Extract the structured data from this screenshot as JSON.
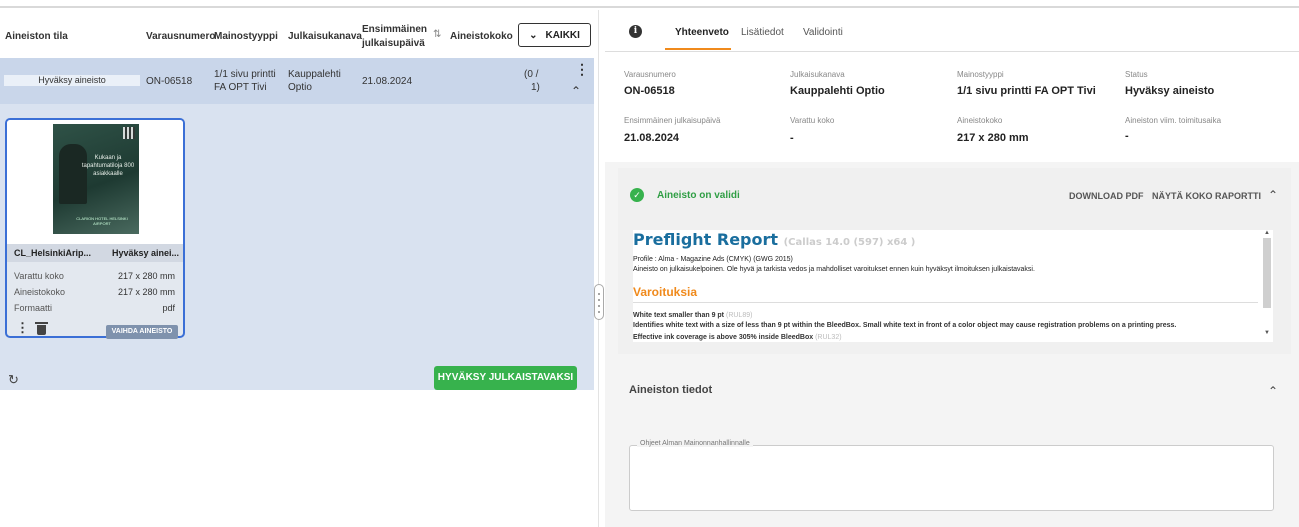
{
  "table": {
    "headers": {
      "aineiston_tila": "Aineiston tila",
      "varausnumero": "Varausnumero",
      "mainostyyppi": "Mainostyyppi",
      "julkaisukanava": "Julkaisukanava",
      "ensimmainen_1": "Ensimmäinen",
      "ensimmainen_2": "julkaisupäivä",
      "aineistokoko": "Aineistokoko"
    },
    "filter_button": "KAIKKI",
    "row": {
      "status": "Hyväksy aineisto",
      "varausnumero": "ON-06518",
      "mainostyyppi_1": "1/1 sivu printti",
      "mainostyyppi_2": "FA OPT Tivi",
      "julkaisukanava_1": "Kauppalehti",
      "julkaisukanava_2": "Optio",
      "paiva": "21.08.2024",
      "koko_1": "(0 /",
      "koko_2": "1)"
    }
  },
  "card": {
    "thumbnail_title": "Kukaan ja tapahtumatiloja 800 asiakkaalle",
    "thumbnail_footer": "CLARION HOTEL HELSINKI AIRPORT",
    "filename": "CL_HelsinkiArip...",
    "status": "Hyväksy ainei...",
    "rows": [
      {
        "label": "Varattu koko",
        "value": "217 x 280 mm"
      },
      {
        "label": "Aineistokoko",
        "value": "217 x 280 mm"
      },
      {
        "label": "Formaatti",
        "value": "pdf"
      }
    ],
    "change_button": "VAIHDA AINEISTO"
  },
  "approve_button": "HYVÄKSY JULKAISTAVAKSI",
  "tabs": {
    "summary": "Yhteenveto",
    "extra": "Lisätiedot",
    "validation": "Validointi"
  },
  "summary": {
    "varausnumero": {
      "label": "Varausnumero",
      "value": "ON-06518"
    },
    "julkaisukanava": {
      "label": "Julkaisukanava",
      "value": "Kauppalehti Optio"
    },
    "mainostyyppi": {
      "label": "Mainostyyppi",
      "value": "1/1 sivu printti FA OPT Tivi"
    },
    "status": {
      "label": "Status",
      "value": "Hyväksy aineisto"
    },
    "ensimmainen": {
      "label": "Ensimmäinen julkaisupäivä",
      "value": "21.08.2024"
    },
    "varattu_koko": {
      "label": "Varattu koko",
      "value": "-"
    },
    "aineistokoko": {
      "label": "Aineistokoko",
      "value": "217 x 280 mm"
    },
    "toimitusaika": {
      "label": "Aineiston viim. toimitusaika",
      "value": "-"
    }
  },
  "preflight": {
    "valid_text": "Aineisto on validi",
    "download_pdf": "DOWNLOAD PDF",
    "show_report": "NÄYTÄ KOKO RAPORTTI",
    "report_title": "Preflight Report",
    "report_version": "(Callas 14.0 (597) x64 )",
    "profile": "Profile : Alma - Magazine Ads (CMYK) (GWG 2015)",
    "note": "Aineisto on julkaisukelpoinen. Ole hyvä ja tarkista vedos ja mahdolliset varoitukset ennen kuin hyväksyt ilmoituksen julkaistavaksi.",
    "warnings_title": "Varoituksia",
    "items": [
      {
        "text": "White text smaller than 9 pt",
        "code": "(RUL89)"
      },
      {
        "text": "Identifies white text with a size of less than 9 pt within the BleedBox. Small white text in front of a color object may cause registration problems on a printing press.",
        "code": ""
      },
      {
        "text": "Effective ink coverage is above 305% inside BleedBox",
        "code": "(RUL32)"
      }
    ]
  },
  "details": {
    "title": "Aineiston tiedot",
    "textarea_label": "Ohjeet Alman Mainonnanhallinnalle"
  }
}
